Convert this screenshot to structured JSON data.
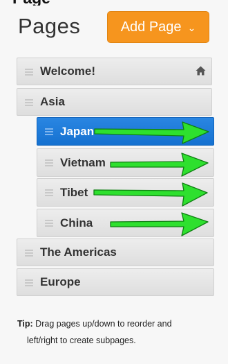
{
  "cut_heading": "Page",
  "header": {
    "title": "Pages",
    "add_button": "Add Page",
    "add_caret": "⌄"
  },
  "pages": [
    {
      "label": "Welcome!",
      "home": true
    },
    {
      "label": "Asia"
    },
    {
      "label": "Japan",
      "selected": true
    },
    {
      "label": "Vietnam"
    },
    {
      "label": "Tibet"
    },
    {
      "label": "China"
    },
    {
      "label": "The Americas"
    },
    {
      "label": "Europe"
    }
  ],
  "tip": {
    "label": "Tip:",
    "line1": "Drag pages up/down to reorder and",
    "line2": "left/right to create subpages."
  },
  "colors": {
    "accent": "#f6951e",
    "selected": "#1e7ad8",
    "arrow_fill": "#2ee02e",
    "arrow_stroke": "#0f7f12"
  }
}
